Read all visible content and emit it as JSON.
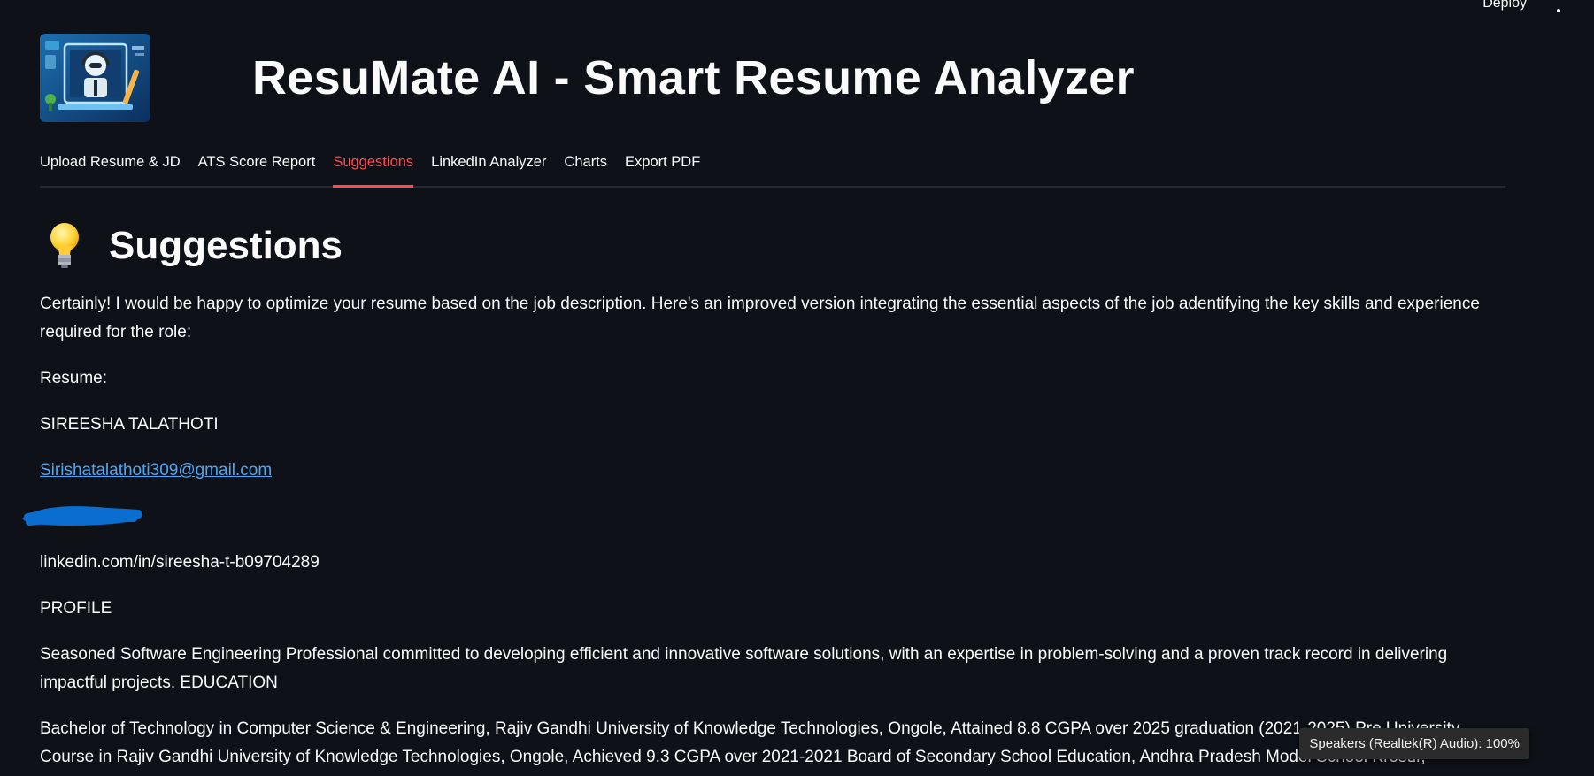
{
  "toolbar": {
    "deploy_label": "Deploy",
    "menu_icon": "more-vertical-icon"
  },
  "header": {
    "logo_icon": "robot-resume-logo",
    "title": "ResuMate AI - Smart Resume Analyzer"
  },
  "tabs": [
    {
      "label": "Upload Resume & JD",
      "active": false
    },
    {
      "label": "ATS Score Report",
      "active": false
    },
    {
      "label": "Suggestions",
      "active": true
    },
    {
      "label": "LinkedIn Analyzer",
      "active": false
    },
    {
      "label": "Charts",
      "active": false
    },
    {
      "label": "Export PDF",
      "active": false
    }
  ],
  "content": {
    "heading_icon": "lightbulb-icon",
    "heading": "Suggestions",
    "intro": "Certainly! I would be happy to optimize your resume based on the job description. Here's an improved version integrating the essential aspects of the job adentifying the key skills and experience required for the role:",
    "resume_label": "Resume:",
    "name": "SIREESHA TALATHOTI",
    "email": "Sirishatalathoti309@gmail.com",
    "linkedin": "linkedin.com/in/sireesha-t-b09704289",
    "profile_heading": "PROFILE",
    "profile_text": "Seasoned Software Engineering Professional committed to developing efficient and innovative software solutions, with an expertise in problem-solving and a proven track record in delivering impactful projects. EDUCATION",
    "education_text": "Bachelor of Technology in Computer Science & Engineering, Rajiv Gandhi University of Knowledge Technologies, Ongole, Attained 8.8 CGPA over 2025 graduation (2021-2025) Pre University Course in Rajiv Gandhi University of Knowledge Technologies, Ongole, Achieved 9.3 CGPA over 2021-2021 Board of Secondary School Education, Andhra Pradesh Model School Krosur,"
  },
  "toast": {
    "text": "Speakers (Realtek(R) Audio): 100%"
  },
  "colors": {
    "background": "#0e1117",
    "accent": "#ff4b4b",
    "link": "#4ea6f5",
    "redaction": "#0a6ed1"
  }
}
